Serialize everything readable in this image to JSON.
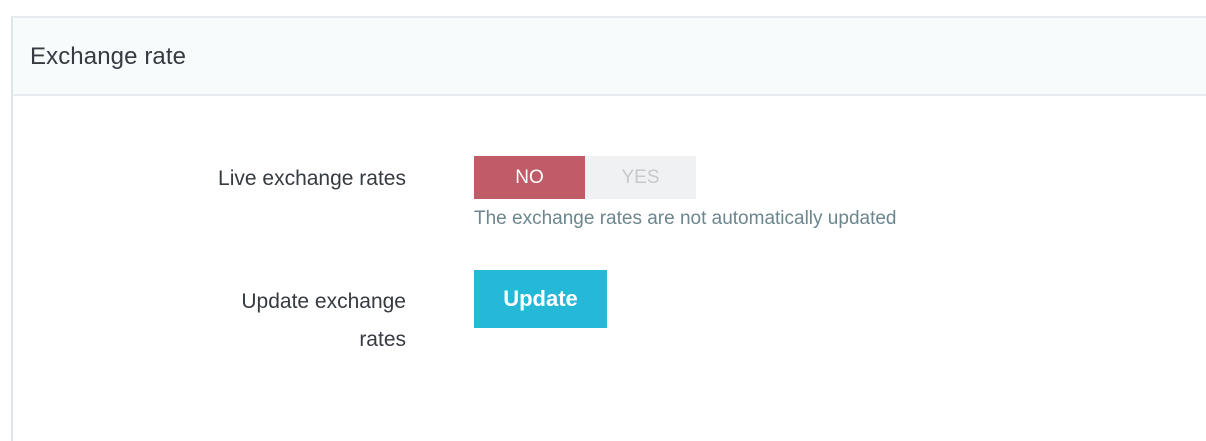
{
  "panel": {
    "title": "Exchange rate"
  },
  "live_rates": {
    "label": "Live exchange rates",
    "options": [
      "NO",
      "YES"
    ],
    "selected": "NO",
    "help": "The exchange rates are not automatically updated"
  },
  "update_rates": {
    "label_line1": "Update exchange",
    "label_line2": "rates",
    "button_label": "Update"
  },
  "colors": {
    "no_active": "#c05c67",
    "update_button": "#25b9d7",
    "help_text": "#6c868e"
  }
}
